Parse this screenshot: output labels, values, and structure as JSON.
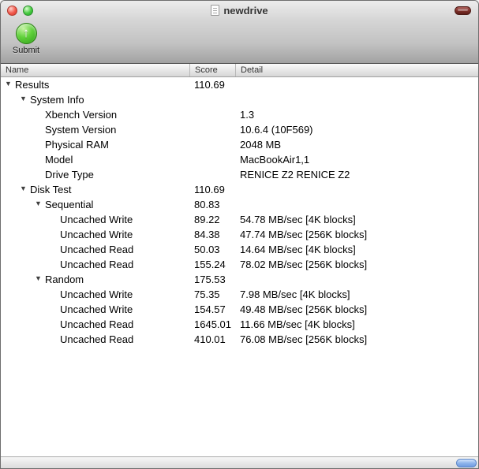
{
  "window": {
    "title": "newdrive"
  },
  "toolbar": {
    "submit_label": "Submit"
  },
  "table": {
    "columns": [
      "Name",
      "Score",
      "Detail"
    ],
    "rows": [
      {
        "name": "Results",
        "score": "110.69",
        "detail": "",
        "level": 0,
        "disclosure": true
      },
      {
        "name": "System Info",
        "score": "",
        "detail": "",
        "level": 1,
        "disclosure": true
      },
      {
        "name": "Xbench Version",
        "score": "",
        "detail": "1.3",
        "level": 2,
        "disclosure": false
      },
      {
        "name": "System Version",
        "score": "",
        "detail": "10.6.4 (10F569)",
        "level": 2,
        "disclosure": false
      },
      {
        "name": "Physical RAM",
        "score": "",
        "detail": "2048 MB",
        "level": 2,
        "disclosure": false
      },
      {
        "name": "Model",
        "score": "",
        "detail": "MacBookAir1,1",
        "level": 2,
        "disclosure": false
      },
      {
        "name": "Drive Type",
        "score": "",
        "detail": "RENICE Z2 RENICE Z2",
        "level": 2,
        "disclosure": false
      },
      {
        "name": "Disk Test",
        "score": "110.69",
        "detail": "",
        "level": 1,
        "disclosure": true
      },
      {
        "name": "Sequential",
        "score": "80.83",
        "detail": "",
        "level": 2,
        "disclosure": true
      },
      {
        "name": "Uncached Write",
        "score": "89.22",
        "detail": "54.78 MB/sec [4K blocks]",
        "level": 3,
        "disclosure": false
      },
      {
        "name": "Uncached Write",
        "score": "84.38",
        "detail": "47.74 MB/sec [256K blocks]",
        "level": 3,
        "disclosure": false
      },
      {
        "name": "Uncached Read",
        "score": "50.03",
        "detail": "14.64 MB/sec [4K blocks]",
        "level": 3,
        "disclosure": false
      },
      {
        "name": "Uncached Read",
        "score": "155.24",
        "detail": "78.02 MB/sec [256K blocks]",
        "level": 3,
        "disclosure": false
      },
      {
        "name": "Random",
        "score": "175.53",
        "detail": "",
        "level": 2,
        "disclosure": true
      },
      {
        "name": "Uncached Write",
        "score": "75.35",
        "detail": "7.98 MB/sec [4K blocks]",
        "level": 3,
        "disclosure": false
      },
      {
        "name": "Uncached Write",
        "score": "154.57",
        "detail": "49.48 MB/sec [256K blocks]",
        "level": 3,
        "disclosure": false
      },
      {
        "name": "Uncached Read",
        "score": "1645.01",
        "detail": "11.66 MB/sec [4K blocks]",
        "level": 3,
        "disclosure": false
      },
      {
        "name": "Uncached Read",
        "score": "410.01",
        "detail": "76.08 MB/sec [256K blocks]",
        "level": 3,
        "disclosure": false
      }
    ]
  },
  "icons": {
    "submit_arrow": "↑",
    "disclosure": "▼"
  },
  "colors": {
    "close_red": "#f1574a",
    "zoom_green": "#45c93f",
    "submit_green": "#2f9e18",
    "toolbar_pill_maroon": "#7c2e28",
    "scroll_thumb_aqua": "#8fb5ec"
  }
}
